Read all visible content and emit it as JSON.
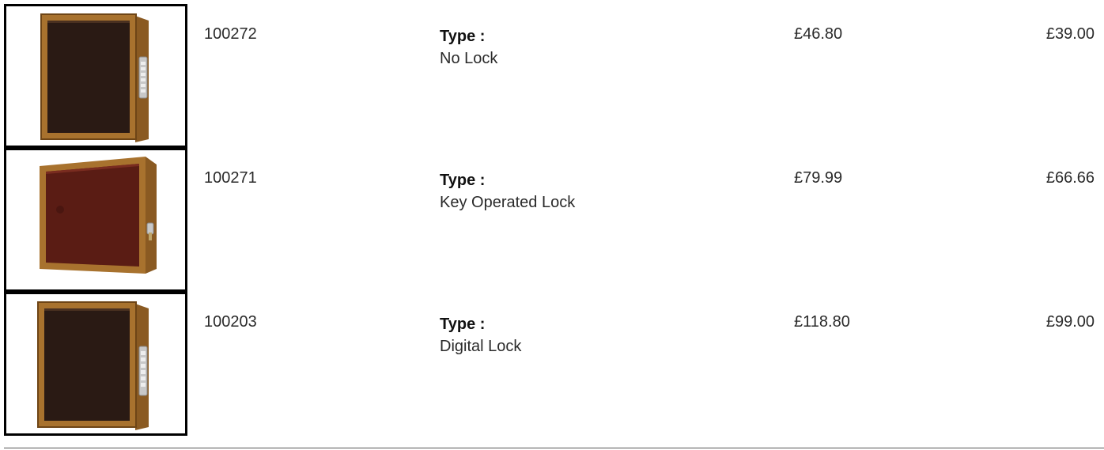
{
  "products": [
    {
      "code": "100272",
      "type_label": "Type :",
      "type_value": "No Lock",
      "price_inc_vat": "£46.80",
      "price_ex_vat": "£39.00",
      "image_icon": "key-cabinet-digital-lock-image",
      "panel_color": "#2a1a14"
    },
    {
      "code": "100271",
      "type_label": "Type :",
      "type_value": "Key Operated Lock",
      "price_inc_vat": "£79.99",
      "price_ex_vat": "£66.66",
      "image_icon": "key-cabinet-key-lock-image",
      "panel_color": "#5a1c14"
    },
    {
      "code": "100203",
      "type_label": "Type :",
      "type_value": "Digital Lock",
      "price_inc_vat": "£118.80",
      "price_ex_vat": "£99.00",
      "image_icon": "key-cabinet-digital-lock-image",
      "panel_color": "#2a1a14"
    }
  ]
}
